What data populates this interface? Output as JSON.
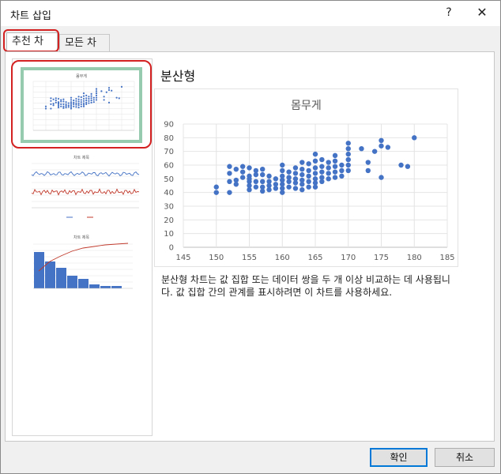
{
  "window": {
    "title": "차트 삽입",
    "help_label": "?",
    "close_label": "✕"
  },
  "tabs": [
    {
      "label": "추천 차트",
      "active": true
    },
    {
      "label": "모든 차트",
      "active": false
    }
  ],
  "thumbnails": [
    {
      "title": "몸무게",
      "kind": "scatter",
      "selected": true
    },
    {
      "title": "차트 제목",
      "kind": "line",
      "selected": false
    },
    {
      "title": "차트 제목",
      "kind": "pareto",
      "selected": false
    }
  ],
  "preview": {
    "type_name": "분산형"
  },
  "chart_data": {
    "type": "scatter",
    "title": "몸무게",
    "xlim": [
      145,
      185
    ],
    "ylim": [
      0,
      90
    ],
    "xticks": [
      145,
      150,
      155,
      160,
      165,
      170,
      175,
      180,
      185
    ],
    "yticks": [
      0,
      10,
      20,
      30,
      40,
      50,
      60,
      70,
      80,
      90
    ],
    "grid": true,
    "marker_color": "#4472c4",
    "points": [
      [
        150,
        44
      ],
      [
        150,
        40
      ],
      [
        152,
        59
      ],
      [
        152,
        54
      ],
      [
        152,
        40
      ],
      [
        152,
        48
      ],
      [
        153,
        49
      ],
      [
        153,
        46
      ],
      [
        153,
        57
      ],
      [
        154,
        59
      ],
      [
        154,
        55
      ],
      [
        154,
        51
      ],
      [
        155,
        58
      ],
      [
        155,
        52
      ],
      [
        155,
        48
      ],
      [
        155,
        45
      ],
      [
        155,
        42
      ],
      [
        155,
        50
      ],
      [
        156,
        56
      ],
      [
        156,
        48
      ],
      [
        156,
        44
      ],
      [
        156,
        53
      ],
      [
        157,
        57
      ],
      [
        157,
        53
      ],
      [
        157,
        48
      ],
      [
        157,
        44
      ],
      [
        157,
        41
      ],
      [
        158,
        52
      ],
      [
        158,
        48
      ],
      [
        158,
        45
      ],
      [
        158,
        42
      ],
      [
        159,
        50
      ],
      [
        159,
        46
      ],
      [
        159,
        43
      ],
      [
        160,
        60
      ],
      [
        160,
        56
      ],
      [
        160,
        52
      ],
      [
        160,
        49
      ],
      [
        160,
        46
      ],
      [
        160,
        43
      ],
      [
        160,
        40
      ],
      [
        161,
        55
      ],
      [
        161,
        51
      ],
      [
        161,
        48
      ],
      [
        161,
        44
      ],
      [
        162,
        58
      ],
      [
        162,
        54
      ],
      [
        162,
        50
      ],
      [
        162,
        47
      ],
      [
        162,
        43
      ],
      [
        163,
        62
      ],
      [
        163,
        57
      ],
      [
        163,
        53
      ],
      [
        163,
        49
      ],
      [
        163,
        46
      ],
      [
        163,
        42
      ],
      [
        164,
        61
      ],
      [
        164,
        56
      ],
      [
        164,
        52
      ],
      [
        164,
        48
      ],
      [
        164,
        44
      ],
      [
        165,
        68
      ],
      [
        165,
        63
      ],
      [
        165,
        58
      ],
      [
        165,
        54
      ],
      [
        165,
        50
      ],
      [
        165,
        47
      ],
      [
        165,
        44
      ],
      [
        166,
        64
      ],
      [
        166,
        59
      ],
      [
        166,
        55
      ],
      [
        166,
        51
      ],
      [
        166,
        48
      ],
      [
        167,
        62
      ],
      [
        167,
        58
      ],
      [
        167,
        54
      ],
      [
        167,
        50
      ],
      [
        168,
        67
      ],
      [
        168,
        63
      ],
      [
        168,
        59
      ],
      [
        168,
        55
      ],
      [
        168,
        51
      ],
      [
        169,
        60
      ],
      [
        169,
        56
      ],
      [
        169,
        52
      ],
      [
        170,
        76
      ],
      [
        170,
        72
      ],
      [
        170,
        68
      ],
      [
        170,
        64
      ],
      [
        170,
        60
      ],
      [
        170,
        56
      ],
      [
        172,
        72
      ],
      [
        173,
        62
      ],
      [
        173,
        56
      ],
      [
        174,
        70
      ],
      [
        175,
        78
      ],
      [
        175,
        74
      ],
      [
        175,
        51
      ],
      [
        176,
        73
      ],
      [
        178,
        60
      ],
      [
        179,
        59
      ],
      [
        180,
        80
      ]
    ]
  },
  "description": "분산형 차트는 값 집합 또는 데이터 쌍을 두 개 이상 비교하는 데 사용됩니다. 값 집합 간의 관계를 표시하려면 이 차트를 사용하세요.",
  "buttons": {
    "ok": "확인",
    "cancel": "취소"
  }
}
